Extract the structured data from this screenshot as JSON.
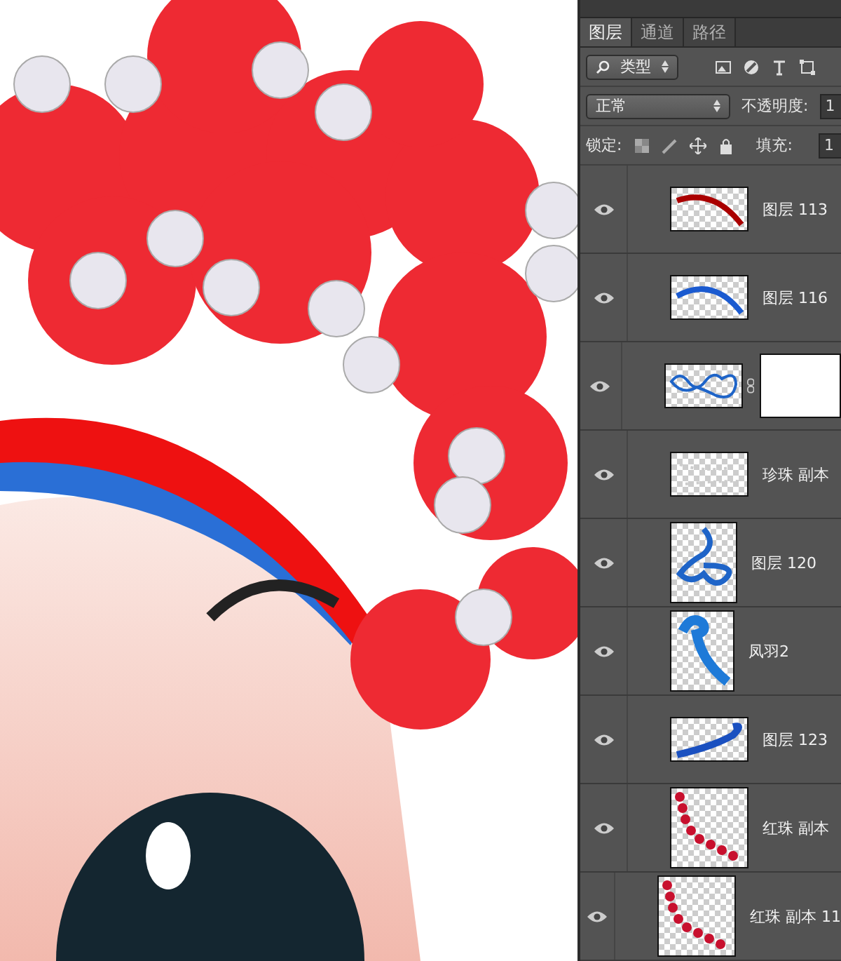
{
  "tabs": [
    {
      "label": "图层",
      "selected": true
    },
    {
      "label": "通道",
      "selected": false
    },
    {
      "label": "路径",
      "selected": false
    }
  ],
  "filter": {
    "value": "类型"
  },
  "blend": {
    "mode": "正常",
    "opacity_label": "不透明度:",
    "opacity": "1"
  },
  "lock": {
    "label": "锁定:",
    "fill_label": "填充:",
    "fill": "1"
  },
  "layers": [
    {
      "name": "图层 113",
      "visible": true,
      "kind": "normal"
    },
    {
      "name": "图层 116",
      "visible": true,
      "kind": "normal"
    },
    {
      "visible": true,
      "kind": "masked"
    },
    {
      "name": "珍珠 副本",
      "visible": true,
      "kind": "normal"
    },
    {
      "name": "图层 120",
      "visible": true,
      "kind": "normal"
    },
    {
      "name": "凤羽2",
      "visible": true,
      "kind": "normal"
    },
    {
      "name": "图层 123",
      "visible": true,
      "kind": "normal"
    },
    {
      "name": "红珠 副本",
      "visible": true,
      "kind": "normal"
    },
    {
      "name": "红珠 副本 11",
      "visible": true,
      "kind": "normal"
    }
  ]
}
